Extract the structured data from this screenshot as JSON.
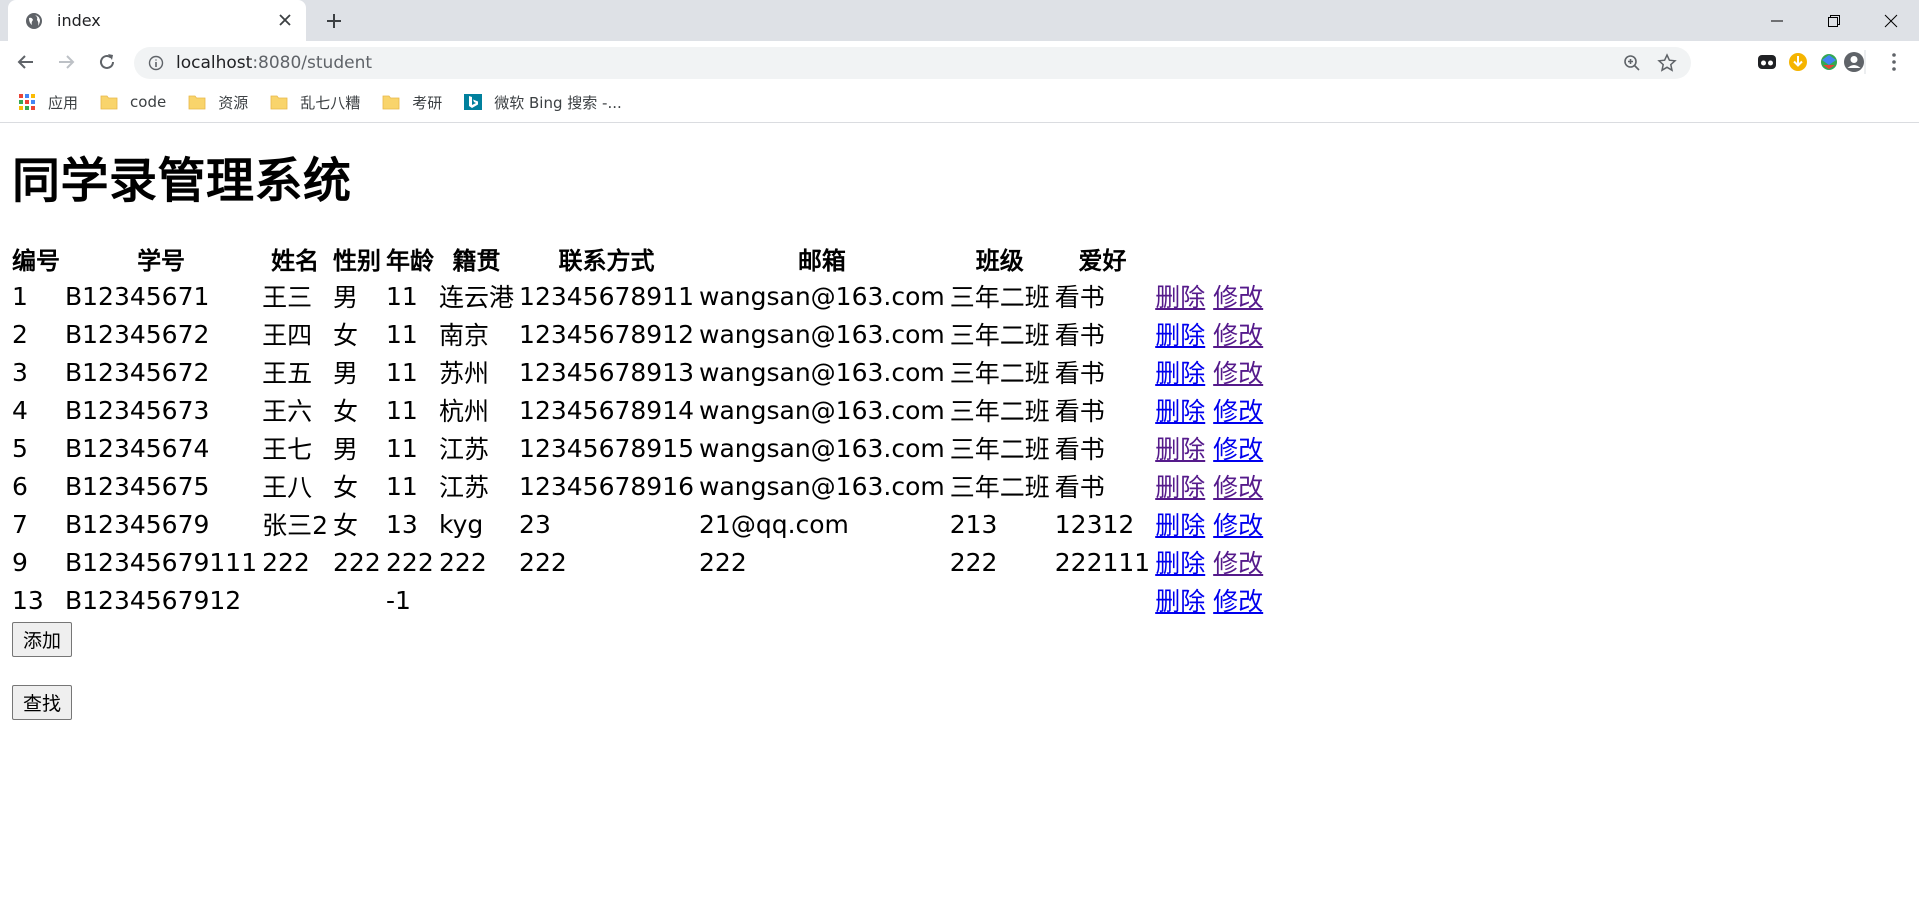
{
  "browser": {
    "tab_title": "index",
    "url_host": "localhost",
    "url_rest": ":8080/student",
    "bookmarks": [
      {
        "icon": "apps-grid-icon",
        "label": "应用"
      },
      {
        "icon": "folder-icon",
        "label": "code"
      },
      {
        "icon": "folder-icon",
        "label": "资源"
      },
      {
        "icon": "folder-icon",
        "label": "乱七八糟"
      },
      {
        "icon": "folder-icon",
        "label": "考研"
      },
      {
        "icon": "bing-icon",
        "label": "微软 Bing 搜索 -..."
      }
    ]
  },
  "page": {
    "title": "同学录管理系统",
    "headers": [
      "编号",
      "学号",
      "姓名",
      "性别",
      "年龄",
      "籍贯",
      "联系方式",
      "邮箱",
      "班级",
      "爱好"
    ],
    "rows": [
      {
        "id": "1",
        "sid": "B12345671",
        "name": "王三",
        "gender": "男",
        "age": "11",
        "origin": "连云港",
        "phone": "12345678911",
        "email": "wangsan@163.com",
        "cls": "三年二班",
        "hobby": "看书",
        "del_visited": true,
        "mod_visited": true
      },
      {
        "id": "2",
        "sid": "B12345672",
        "name": "王四",
        "gender": "女",
        "age": "11",
        "origin": "南京",
        "phone": "12345678912",
        "email": "wangsan@163.com",
        "cls": "三年二班",
        "hobby": "看书",
        "del_visited": false,
        "mod_visited": true
      },
      {
        "id": "3",
        "sid": "B12345672",
        "name": "王五",
        "gender": "男",
        "age": "11",
        "origin": "苏州",
        "phone": "12345678913",
        "email": "wangsan@163.com",
        "cls": "三年二班",
        "hobby": "看书",
        "del_visited": false,
        "mod_visited": true
      },
      {
        "id": "4",
        "sid": "B12345673",
        "name": "王六",
        "gender": "女",
        "age": "11",
        "origin": "杭州",
        "phone": "12345678914",
        "email": "wangsan@163.com",
        "cls": "三年二班",
        "hobby": "看书",
        "del_visited": false,
        "mod_visited": false
      },
      {
        "id": "5",
        "sid": "B12345674",
        "name": "王七",
        "gender": "男",
        "age": "11",
        "origin": "江苏",
        "phone": "12345678915",
        "email": "wangsan@163.com",
        "cls": "三年二班",
        "hobby": "看书",
        "del_visited": true,
        "mod_visited": false
      },
      {
        "id": "6",
        "sid": "B12345675",
        "name": "王八",
        "gender": "女",
        "age": "11",
        "origin": "江苏",
        "phone": "12345678916",
        "email": "wangsan@163.com",
        "cls": "三年二班",
        "hobby": "看书",
        "del_visited": true,
        "mod_visited": true
      },
      {
        "id": "7",
        "sid": "B12345679",
        "name": "张三2",
        "gender": "女",
        "age": "13",
        "origin": "kyg",
        "phone": "23",
        "email": "21@qq.com",
        "cls": "213",
        "hobby": "12312",
        "del_visited": false,
        "mod_visited": false
      },
      {
        "id": "9",
        "sid": "B12345679111",
        "name": "222",
        "gender": "222",
        "age": "222",
        "origin": "222",
        "phone": "222",
        "email": "222",
        "cls": "222",
        "hobby": "222111",
        "del_visited": false,
        "mod_visited": true
      },
      {
        "id": "13",
        "sid": "B1234567912",
        "name": "",
        "gender": "",
        "age": "-1",
        "origin": "",
        "phone": "",
        "email": "",
        "cls": "",
        "hobby": "",
        "del_visited": false,
        "mod_visited": false
      }
    ],
    "delete_label": "删除",
    "modify_label": "修改",
    "add_button": "添加",
    "search_button": "查找"
  }
}
